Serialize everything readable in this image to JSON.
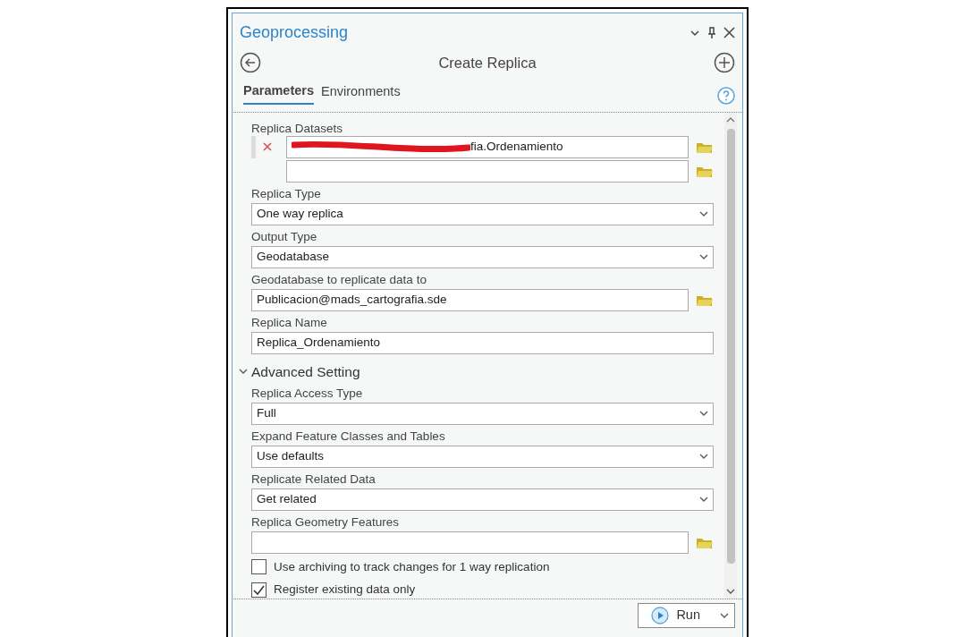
{
  "panel": {
    "title": "Geoprocessing"
  },
  "tool": {
    "title": "Create Replica"
  },
  "tabs": [
    {
      "label": "Parameters",
      "selected": true
    },
    {
      "label": "Environments",
      "selected": false
    }
  ],
  "parameters": [
    {
      "kind": "multi",
      "label": "Replica Datasets",
      "rows": [
        {
          "value": "fia.Ordenamiento",
          "redacted": true,
          "removable": true
        },
        {
          "redacted": false,
          "removable": false
        }
      ]
    },
    {
      "kind": "dropdown",
      "label": "Replica Type",
      "value": "One way replica"
    },
    {
      "kind": "dropdown",
      "label": "Output Type",
      "value": "Geodatabase"
    },
    {
      "kind": "browse",
      "label": "Geodatabase to replicate data to",
      "value": "Publicacion@mads_cartografia.sde"
    },
    {
      "kind": "text",
      "label": "Replica Name",
      "value": "Replica_Ordenamiento"
    },
    {
      "kind": "section",
      "label": "Advanced Setting",
      "expanded": true
    },
    {
      "kind": "dropdown",
      "label": "Replica Access Type",
      "value": "Full"
    },
    {
      "kind": "dropdown",
      "label": "Expand Feature Classes and Tables",
      "value": "Use defaults"
    },
    {
      "kind": "dropdown",
      "label": "Replicate Related Data",
      "value": "Get related"
    },
    {
      "kind": "browse",
      "label": "Replica Geometry Features"
    },
    {
      "kind": "checkbox",
      "label": "Use archiving to track changes for 1 way replication",
      "checked": false
    },
    {
      "kind": "checkbox",
      "label": "Register existing data only",
      "checked": true
    }
  ],
  "run_button": {
    "label": "Run"
  }
}
